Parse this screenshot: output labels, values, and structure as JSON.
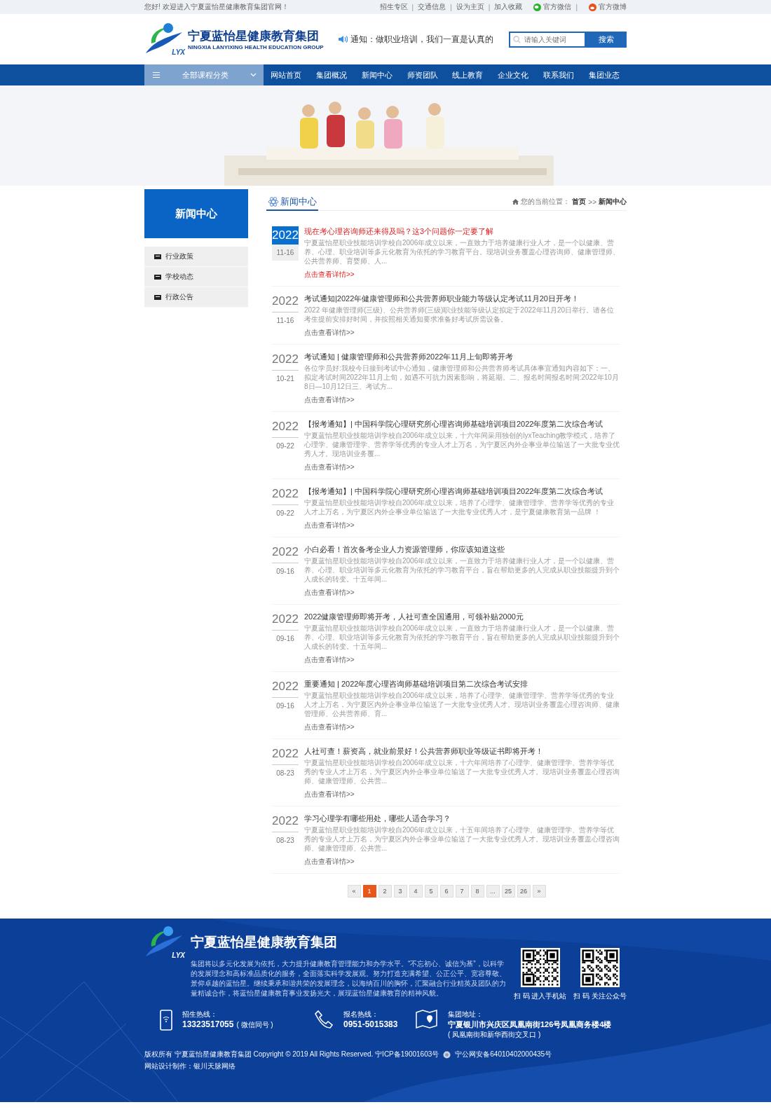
{
  "top_bar": {
    "welcome": "您好! 欢迎进入宁夏蓝怡星健康教育集团官网！",
    "separator": "|",
    "links": [
      "招生专区",
      "交通信息",
      "设为主页",
      "加入收藏"
    ],
    "social": [
      {
        "kind": "wechat",
        "label": "官方微信"
      },
      {
        "kind": "weibo",
        "label": "官方微博"
      }
    ]
  },
  "header": {
    "logo": {
      "mark": "LYX",
      "name": "宁夏蓝怡星健康教育集团",
      "subtitle": "NINGXIA LANYIXING HEALTH EDUCATION GROUP"
    },
    "notice": "通知：做职业培训，我们一直是认真的",
    "search": {
      "placeholder": "请输入关键词",
      "button": "搜索"
    }
  },
  "nav": {
    "category": "全部课程分类",
    "items": [
      {
        "label": "网站首页",
        "selected": false
      },
      {
        "label": "集团概况",
        "selected": false
      },
      {
        "label": "新闻中心",
        "selected": false
      },
      {
        "label": "师资团队",
        "selected": false
      },
      {
        "label": "线上教育",
        "selected": false
      },
      {
        "label": "企业文化",
        "selected": false
      },
      {
        "label": "联系我们",
        "selected": false
      },
      {
        "label": "集团业态",
        "selected": false
      }
    ]
  },
  "sidebar": {
    "title": "新闻中心",
    "items": [
      {
        "label": "行业政策",
        "selected": false
      },
      {
        "label": "学校动态",
        "selected": false
      },
      {
        "label": "行政公告",
        "selected": false
      }
    ]
  },
  "section": {
    "title": "新闻中心",
    "breadcrumb": {
      "prefix": "您的当前位置：",
      "home": "首页",
      "separator": ">>",
      "current": "新闻中心"
    }
  },
  "news": [
    {
      "year": "2022",
      "date": "11-16",
      "title": "现在考心理咨询师还来得及吗？这3个问题你一定要了解",
      "summary": "宁夏蓝怡星职业技能培训学校自2006年成立以来，一直致力于培养健康行业人才，是一个以健康、营养、心理、职业培训等多元化教育为依托的学习教育平台。现培训业务覆盖心理咨询师、健康管理师、公共营养师、育婴师、人...",
      "more": "点击查看详情>>",
      "selected": true
    },
    {
      "year": "2022",
      "date": "11-16",
      "title": "考试通知|2022年健康管理师和公共营养师职业能力等级认定考试11月20日开考！",
      "summary": "2022 年健康管理师(三级)、公共营养师(三级)职业技能等级认定拟定于2022年11月20日举行。请各位考生提前安排好时间，并按照相关通知要求准备好考试所需设备。",
      "more": "点击查看详情>>",
      "selected": false
    },
    {
      "year": "2022",
      "date": "10-21",
      "title": "考试通知 | 健康管理师和公共营养师2022年11月上旬即将开考",
      "summary": "各位学员好:我校今日接到考试中心通知，健康管理师和公共营养师考试具体事宜通知内容如下：一、拟定考试时间2022年11月上旬，如遇不可抗力因素影响，将延期。二、报名时间报名时间:2022年10月8日—10月12日三、考试方...",
      "more": "点击查看详情>>",
      "selected": false
    },
    {
      "year": "2022",
      "date": "09-22",
      "title": "【报考通知】| 中国科学院心理研究所心理咨询师基础培训项目2022年度第二次综合考试",
      "summary": "宁夏蓝怡星职业技能培训学校自2006年成立以来，十六年间采用独创的lyxTeaching教学模式，培养了心理学、健康管理学、营养学等优秀的专业人才上万名，为宁夏区内外企事业单位输送了一大批专业优秀人才。现培训业务覆...",
      "more": "点击查看详情>>",
      "selected": false
    },
    {
      "year": "2022",
      "date": "09-22",
      "title": "【报考通知】| 中国科学院心理研究所心理咨询师基础培训项目2022年度第二次综合考试",
      "summary": "宁夏蓝怡星职业技能培训学校自2006年成立以来，培养了心理学、健康管理学、营养学等优秀的专业人才上万名，为宁夏区内外企事业单位输送了一大批专业优秀人才，是宁夏健康教育第一品牌 ！",
      "more": "点击查看详情>>",
      "selected": false
    },
    {
      "year": "2022",
      "date": "09-16",
      "title": "小白必看！首次备考企业人力资源管理师，你应该知道这些",
      "summary": "宁夏蓝怡星职业技能培训学校自2006年成立以来，一直致力于培养健康行业人才，是一个以健康、营养、心理、职业培训等多元化教育为依托的学习教育平台，旨在帮助更多的人完成从职业技能提升到个人成长的转变。十五年间...",
      "more": "点击查看详情>>",
      "selected": false
    },
    {
      "year": "2022",
      "date": "09-16",
      "title": "2022健康管理师即将开考，人社可查全国通用，可领补贴2000元",
      "summary": "宁夏蓝怡星职业技能培训学校自2006年成立以来，一直致力于培养健康行业人才，是一个以健康、营养、心理、职业培训等多元化教育为依托的学习教育平台，旨在帮助更多的人完成从职业技能提升到个人成长的转变。十五年间...",
      "more": "点击查看详情>>",
      "selected": false
    },
    {
      "year": "2022",
      "date": "09-16",
      "title": "重要通知 | 2022年度心理咨询师基础培训项目第二次综合考试安排",
      "summary": "宁夏蓝怡星职业技能培训学校自2006年成立以来，培养了心理学、健康管理学、营养学等优秀的专业人才上万名，为宁夏区内外企事业单位输送了一大批专业优秀人才。现培训业务覆盖心理咨询师、健康管理师、公共营养师、育...",
      "more": "点击查看详情>>",
      "selected": false
    },
    {
      "year": "2022",
      "date": "08-23",
      "title": "人社可查！薪资高，就业前景好！公共营养师职业等级证书即将开考！",
      "summary": "宁夏蓝怡星职业技能培训学校自2006年成立以来，十六年间培养了心理学、健康管理学、营养学等优秀的专业人才上万名，为宁夏区内外企事业单位输送了一大批专业优秀人才。现培训业务覆盖心理咨询师、健康管理师、公共营...",
      "more": "点击查看详情>>",
      "selected": false
    },
    {
      "year": "2022",
      "date": "08-23",
      "title": "学习心理学有哪些用处，哪些人适合学习？",
      "summary": "宁夏蓝怡星职业技能培训学校自2006年成立以来，十五年间培养了心理学、健康管理学、营养学等优秀的专业人才上万名，为宁夏区内外企事业单位输送了一大批专业优秀人才。现培训业务覆盖心理咨询师、健康管理师、公共营...",
      "more": "点击查看详情>>",
      "selected": false
    }
  ],
  "pagination": {
    "prev": "«",
    "next": "»",
    "pages": [
      {
        "label": "1",
        "selected": true
      },
      {
        "label": "2",
        "selected": false
      },
      {
        "label": "3",
        "selected": false
      },
      {
        "label": "4",
        "selected": false
      },
      {
        "label": "5",
        "selected": false
      },
      {
        "label": "6",
        "selected": false
      },
      {
        "label": "7",
        "selected": false
      },
      {
        "label": "8",
        "selected": false
      },
      {
        "label": "...",
        "selected": false
      },
      {
        "label": "25",
        "selected": false
      },
      {
        "label": "26",
        "selected": false
      }
    ]
  },
  "footer": {
    "logo_mark": "LYX",
    "brand": "宁夏蓝怡星健康教育集团",
    "about": "集团将以多元化发展为依托，大力提升健康教育管理能力和办学水平。“不忘初心、诚信为基”，以科学的发展理念和高标准品质化的服务，全面落实科学发展观。努力打造充满希望、公正公平、宽容尊敬、景仰卓越的蓝怡星。继续秉承和谐共荣的发展理念，以海纳百川的胸怀，汇聚融合行业精英及团队的力量精诚合作，将蓝怡星健康教育事业发扬光大，展现蓝怡星健康教育的精神风貌。",
    "qr_codes": [
      {
        "caption": "扫 码 进入手机站"
      },
      {
        "caption": "扫 码 关注公众号"
      }
    ],
    "contacts": [
      {
        "kind": "mobile",
        "label": "招生热线：",
        "value": "13323517055",
        "note": "( 微信同号 )"
      },
      {
        "kind": "phone",
        "label": "报名热线：",
        "value": "0951-5015383"
      },
      {
        "kind": "map",
        "label": "集团地址：",
        "value": "宁夏银川市兴庆区凤凰南街126号凤凰商务楼4楼",
        "note": "( 凤凰南街和新华西街交叉口 )"
      }
    ],
    "copyright": "版权所有 宁夏蓝怡星健康教育集团 Copyright © 2019 All Rights Reserved. 宁ICP备19001603号",
    "police": "宁公网安备64010402000435号",
    "credit": "网站设计制作：银川天脉网络"
  }
}
